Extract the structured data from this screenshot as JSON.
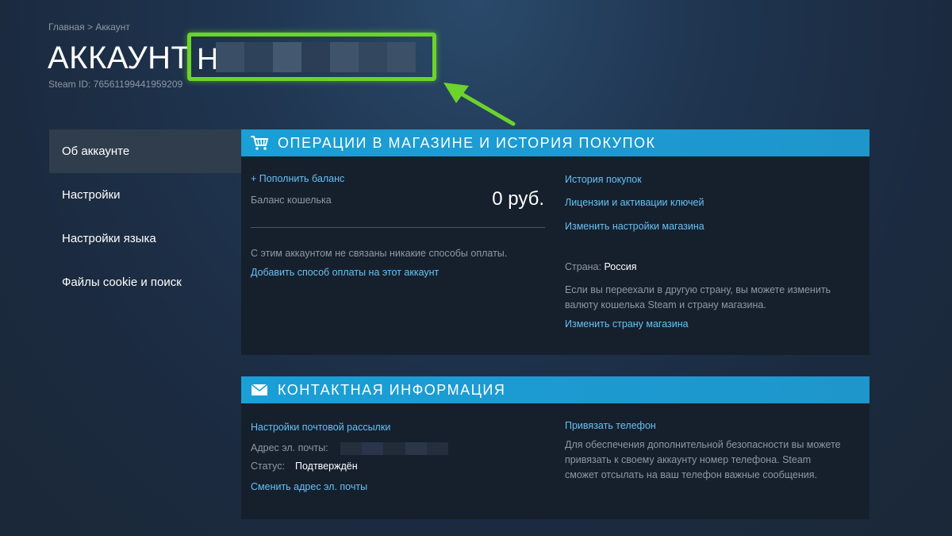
{
  "breadcrumb": {
    "home": "Главная",
    "separator": ">",
    "current": "Аккаунт"
  },
  "page": {
    "title": "АККАУНТ",
    "name_initial": "Н",
    "steam_id": "Steam ID: 76561199441959209"
  },
  "sidebar": {
    "items": [
      {
        "label": "Об аккаунте",
        "active": true
      },
      {
        "label": "Настройки",
        "active": false
      },
      {
        "label": "Настройки языка",
        "active": false
      },
      {
        "label": "Файлы cookie и поиск",
        "active": false
      }
    ]
  },
  "store_panel": {
    "header": "ОПЕРАЦИИ В МАГАЗИНЕ И ИСТОРИЯ ПОКУПОК",
    "icon": "cart-icon",
    "add_funds": "+ Пополнить баланс",
    "wallet_label": "Баланс кошелька",
    "wallet_value": "0 руб.",
    "no_payment": "С этим аккаунтом не связаны никакие способы оплаты.",
    "add_payment": "Добавить способ оплаты на этот аккаунт",
    "purchase_history": "История покупок",
    "licenses": "Лицензии и активации ключей",
    "store_prefs": "Изменить настройки магазина",
    "country_label": "Страна:",
    "country_value": "Россия",
    "move_note_1": "Если вы переехали в другую страну, вы можете изменить",
    "move_note_2": "валюту кошелька Steam и страну магазина.",
    "change_country": "Изменить страну магазина"
  },
  "contact_panel": {
    "header": "КОНТАКТНАЯ ИНФОРМАЦИЯ",
    "icon": "envelope-icon",
    "newsletter": "Настройки почтовой рассылки",
    "email_label": "Адрес эл. почты:",
    "status_label": "Статус:",
    "status_value": "Подтверждён",
    "change_email": "Сменить адрес эл. почты",
    "link_phone": "Привязать телефон",
    "phone_note_1": "Для обеспечения дополнительной безопасности вы можете",
    "phone_note_2": "привязать к своему аккаунту номер телефона. Steam",
    "phone_note_3": "сможет отсылать на ваш телефон важные сообщения."
  },
  "colors": {
    "highlight": "#6cd32a",
    "header_blue": "#1a9fd6",
    "link": "#66c0f4"
  }
}
